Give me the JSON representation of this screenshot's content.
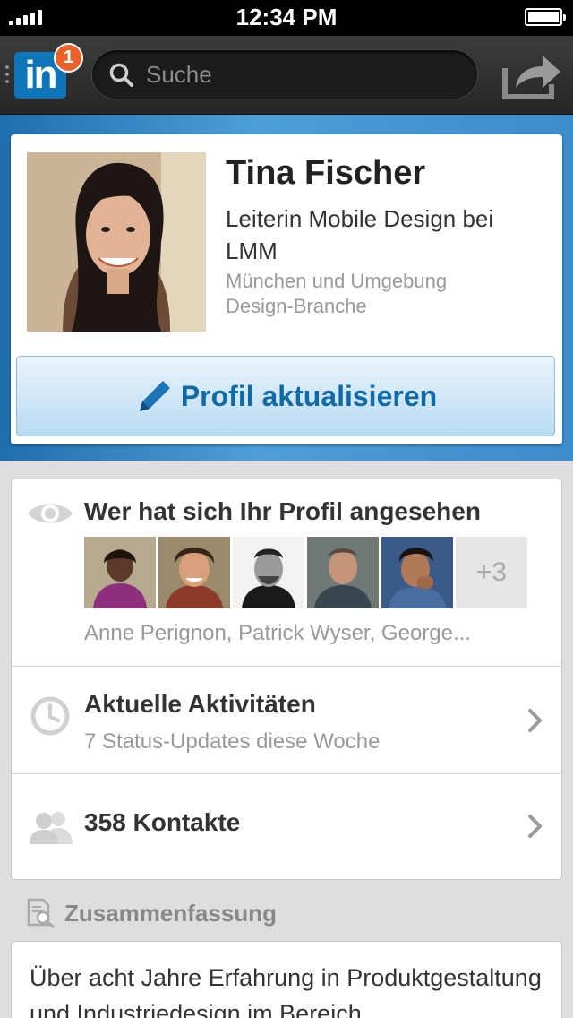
{
  "status_bar": {
    "time": "12:34 PM"
  },
  "navbar": {
    "logo_text": "in",
    "notification_count": "1",
    "search_placeholder": "Suche"
  },
  "profile": {
    "name": "Tina Fischer",
    "title": "Leiterin Mobile Design bei LMM",
    "location": "München und Umgebung",
    "industry": "Design-Branche",
    "update_button": "Profil aktualisieren"
  },
  "viewers": {
    "title": "Wer hat sich Ihr Profil angesehen",
    "more_count": "+3",
    "names": "Anne Perignon, Patrick Wyser, George..."
  },
  "activity": {
    "title": "Aktuelle Aktivitäten",
    "subtitle": "7 Status-Updates diese Woche"
  },
  "contacts": {
    "label": "358 Kontakte"
  },
  "summary": {
    "title": "Zusammenfassung",
    "text": "Über acht Jahre Erfahrung in Produktgestaltung und Industriedesign im Bereich"
  },
  "colors": {
    "brand_blue": "#0e76b8",
    "badge_orange": "#e8622a",
    "button_text_blue": "#0f6aa8"
  }
}
